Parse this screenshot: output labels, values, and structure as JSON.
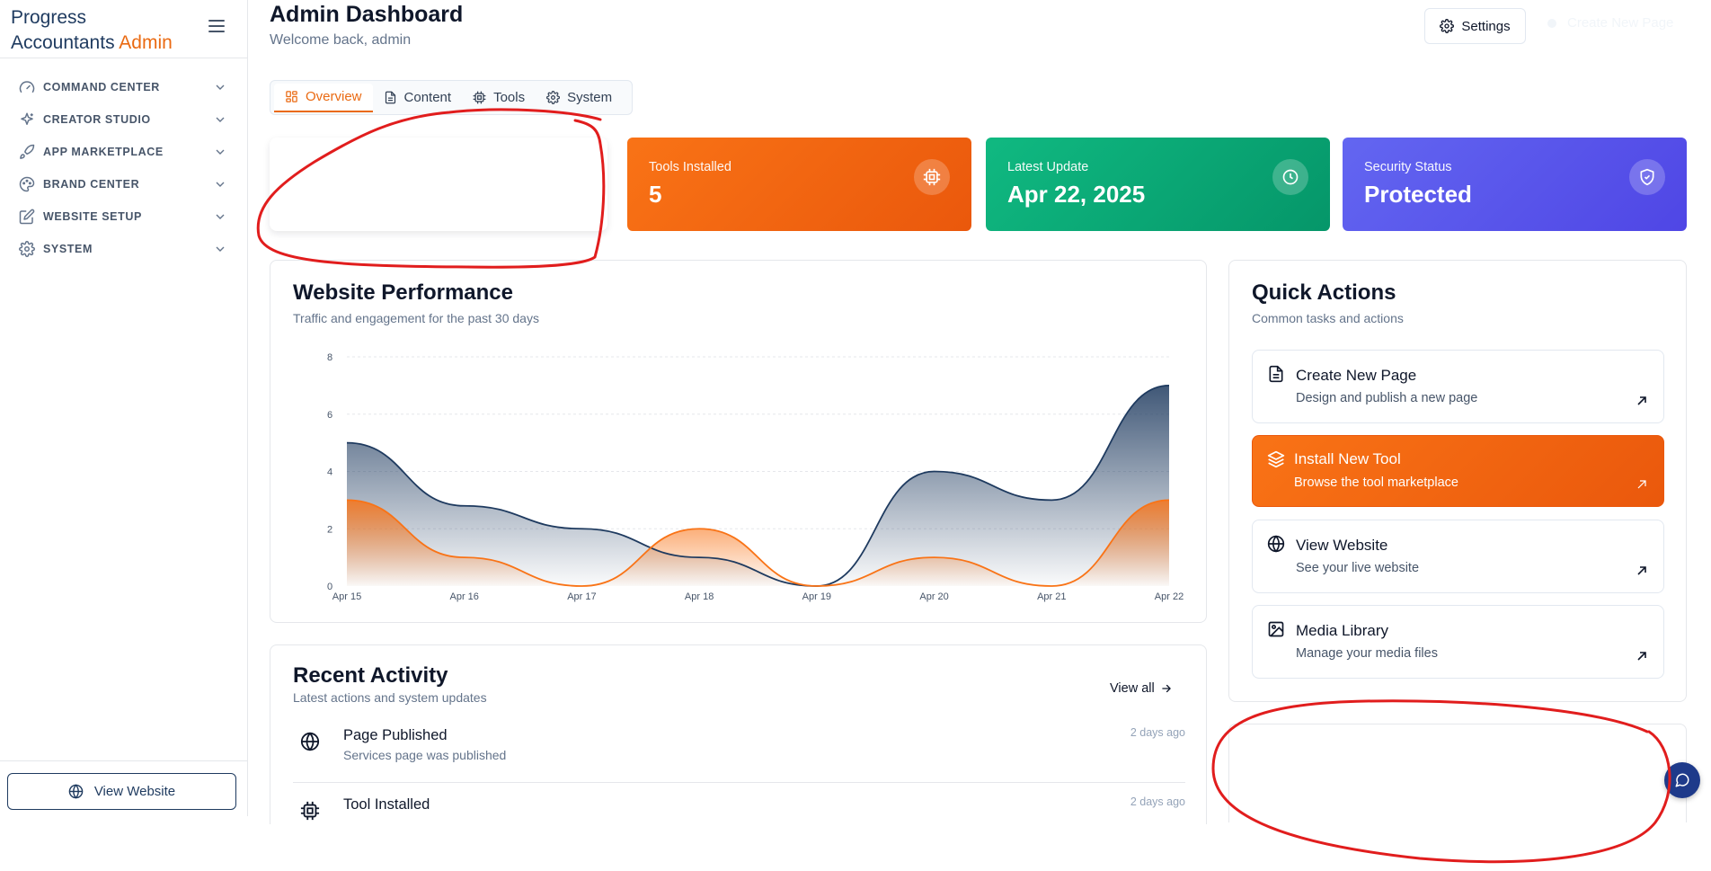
{
  "brand": {
    "line1": "Progress",
    "line2_main": "Accountants",
    "line2_accent": "Admin"
  },
  "sidebar": {
    "items": [
      {
        "label": "COMMAND CENTER",
        "icon": "gauge-icon"
      },
      {
        "label": "CREATOR STUDIO",
        "icon": "sparkles-icon"
      },
      {
        "label": "APP MARKETPLACE",
        "icon": "rocket-icon"
      },
      {
        "label": "BRAND CENTER",
        "icon": "palette-icon"
      },
      {
        "label": "WEBSITE SETUP",
        "icon": "edit-icon"
      },
      {
        "label": "SYSTEM",
        "icon": "gear-icon"
      }
    ],
    "view_website": "View Website"
  },
  "header": {
    "title": "Admin Dashboard",
    "subtitle": "Welcome back, admin",
    "settings_label": "Settings",
    "create_label": "Create New Page"
  },
  "tabs": [
    {
      "label": "Overview",
      "active": true
    },
    {
      "label": "Content",
      "active": false
    },
    {
      "label": "Tools",
      "active": false
    },
    {
      "label": "System",
      "active": false
    }
  ],
  "stats": [
    {
      "label": "Tools Installed",
      "value": "5",
      "color": "#f97316",
      "icon": "cpu-icon"
    },
    {
      "label": "Latest Update",
      "value": "Apr 22, 2025",
      "color": "#10b981",
      "icon": "clock-icon"
    },
    {
      "label": "Security Status",
      "value": "Protected",
      "color": "#6366f1",
      "icon": "shield-check-icon"
    }
  ],
  "performance": {
    "title": "Website Performance",
    "subtitle": "Traffic and engagement for the past 30 days"
  },
  "chart_data": {
    "type": "area",
    "categories": [
      "Apr 15",
      "Apr 16",
      "Apr 17",
      "Apr 18",
      "Apr 19",
      "Apr 20",
      "Apr 21",
      "Apr 22"
    ],
    "series": [
      {
        "values": [
          5,
          2.8,
          2,
          1,
          0,
          4,
          3,
          7
        ],
        "color": "#1e3a5f"
      },
      {
        "values": [
          3,
          1,
          0,
          2,
          0,
          1,
          0,
          3
        ],
        "color": "#f97316"
      }
    ],
    "yticks": [
      0,
      2,
      4,
      6,
      8
    ],
    "ylim": [
      0,
      8
    ],
    "grid": true
  },
  "activity": {
    "title": "Recent Activity",
    "subtitle": "Latest actions and system updates",
    "view_all": "View all",
    "items": [
      {
        "title": "Page Published",
        "desc": "Services page was published",
        "time": "2 days ago",
        "icon": "globe-icon"
      },
      {
        "title": "Tool Installed",
        "desc": "",
        "time": "2 days ago",
        "icon": "cpu-icon"
      }
    ]
  },
  "quick_actions": {
    "title": "Quick Actions",
    "subtitle": "Common tasks and actions",
    "items": [
      {
        "title": "Create New Page",
        "desc": "Design and publish a new page",
        "icon": "file-icon"
      },
      {
        "title": "Install New Tool",
        "desc": "Browse the tool marketplace",
        "icon": "layers-icon"
      },
      {
        "title": "View Website",
        "desc": "See your live website",
        "icon": "globe-icon"
      },
      {
        "title": "Media Library",
        "desc": "Manage your media files",
        "icon": "image-icon"
      }
    ]
  },
  "colors": {
    "accent": "#ea6a12",
    "brand": "#1e3a5f",
    "annotation": "#e11d1d"
  }
}
